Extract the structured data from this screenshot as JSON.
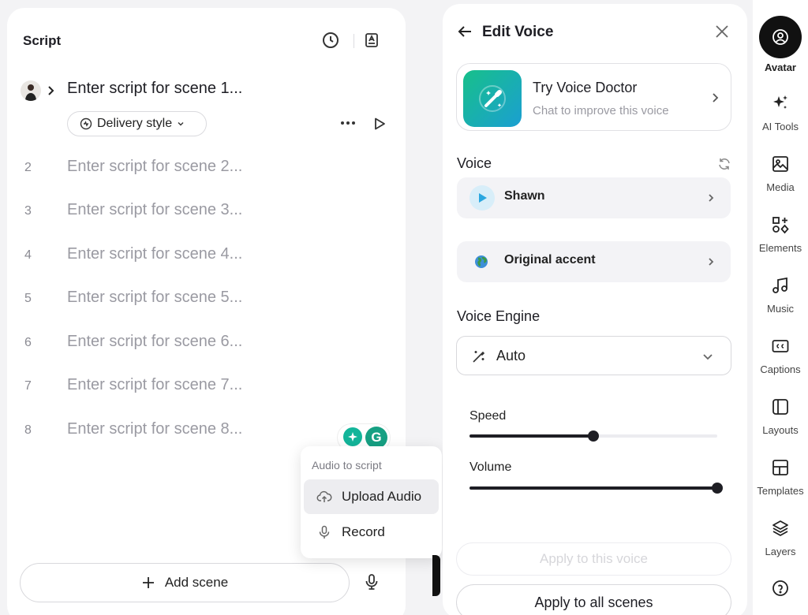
{
  "script": {
    "title": "Script",
    "scene1_placeholder": "Enter script for scene 1...",
    "delivery_style": "Delivery style",
    "scenes": [
      {
        "num": "2",
        "placeholder": "Enter script for scene 2..."
      },
      {
        "num": "3",
        "placeholder": "Enter script for scene 3..."
      },
      {
        "num": "4",
        "placeholder": "Enter script for scene 4..."
      },
      {
        "num": "5",
        "placeholder": "Enter script for scene 5..."
      },
      {
        "num": "6",
        "placeholder": "Enter script for scene 6..."
      },
      {
        "num": "7",
        "placeholder": "Enter script for scene 7..."
      },
      {
        "num": "8",
        "placeholder": "Enter script for scene 8..."
      }
    ],
    "add_scene": "Add scene",
    "grammarly_letter": "G"
  },
  "audio_menu": {
    "title": "Audio to script",
    "upload": "Upload Audio",
    "record": "Record"
  },
  "edit_voice": {
    "title": "Edit Voice",
    "doctor_title": "Try Voice Doctor",
    "doctor_subtitle": "Chat to improve this voice",
    "voice_label": "Voice",
    "voice_name": "Shawn",
    "accent": "Original accent",
    "engine_label": "Voice Engine",
    "engine_value": "Auto",
    "speed_label": "Speed",
    "speed_value": 0.5,
    "volume_label": "Volume",
    "volume_value": 1.0,
    "apply_voice": "Apply to this voice",
    "apply_all": "Apply to all scenes"
  },
  "toolbar": {
    "items": [
      {
        "label": "Avatar",
        "icon": "avatar-icon"
      },
      {
        "label": "AI Tools",
        "icon": "sparkle-icon"
      },
      {
        "label": "Media",
        "icon": "image-icon"
      },
      {
        "label": "Elements",
        "icon": "shapes-icon"
      },
      {
        "label": "Music",
        "icon": "music-icon"
      },
      {
        "label": "Captions",
        "icon": "cc-icon"
      },
      {
        "label": "Layouts",
        "icon": "layout-icon"
      },
      {
        "label": "Templates",
        "icon": "template-icon"
      },
      {
        "label": "Layers",
        "icon": "layers-icon"
      }
    ]
  },
  "colors": {
    "accent_dark": "#1e1e24",
    "doctor_gradient_start": "#17c08a",
    "doctor_gradient_end": "#1b9fd2",
    "play_blue": "#2aa7e0"
  }
}
